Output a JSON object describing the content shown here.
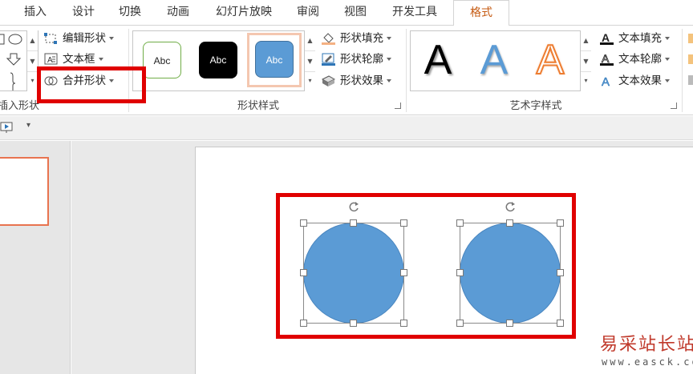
{
  "tabs": [
    {
      "label": "插入",
      "active": false
    },
    {
      "label": "设计",
      "active": false
    },
    {
      "label": "切换",
      "active": false
    },
    {
      "label": "动画",
      "active": false
    },
    {
      "label": "幻灯片放映",
      "active": false
    },
    {
      "label": "审阅",
      "active": false
    },
    {
      "label": "视图",
      "active": false
    },
    {
      "label": "开发工具",
      "active": false
    },
    {
      "label": "格式",
      "active": true
    }
  ],
  "groups": {
    "insert_shapes": {
      "label": "插入形状",
      "edit_shape": "编辑形状",
      "text_box": "文本框",
      "merge_shapes": "合并形状"
    },
    "shape_styles": {
      "label": "形状样式",
      "swatches": [
        {
          "text": "Abc",
          "variant": "outline-green"
        },
        {
          "text": "Abc",
          "variant": "black-fill"
        },
        {
          "text": "Abc",
          "variant": "blue-fill-selected"
        }
      ],
      "fill": "形状填充",
      "outline": "形状轮廓",
      "effects": "形状效果"
    },
    "wordart_styles": {
      "label": "艺术字样式",
      "samples": [
        "A",
        "A",
        "A"
      ],
      "text_fill": "文本填充",
      "text_outline": "文本轮廓",
      "text_effects": "文本效果"
    }
  },
  "colors": {
    "accent_orange": "#c55a11",
    "shape_blue": "#5b9bd5",
    "highlight_red": "#e00000",
    "thumb_border": "#e8734f"
  },
  "watermark": {
    "title": "易采站长站",
    "url": "www.easck.com"
  }
}
